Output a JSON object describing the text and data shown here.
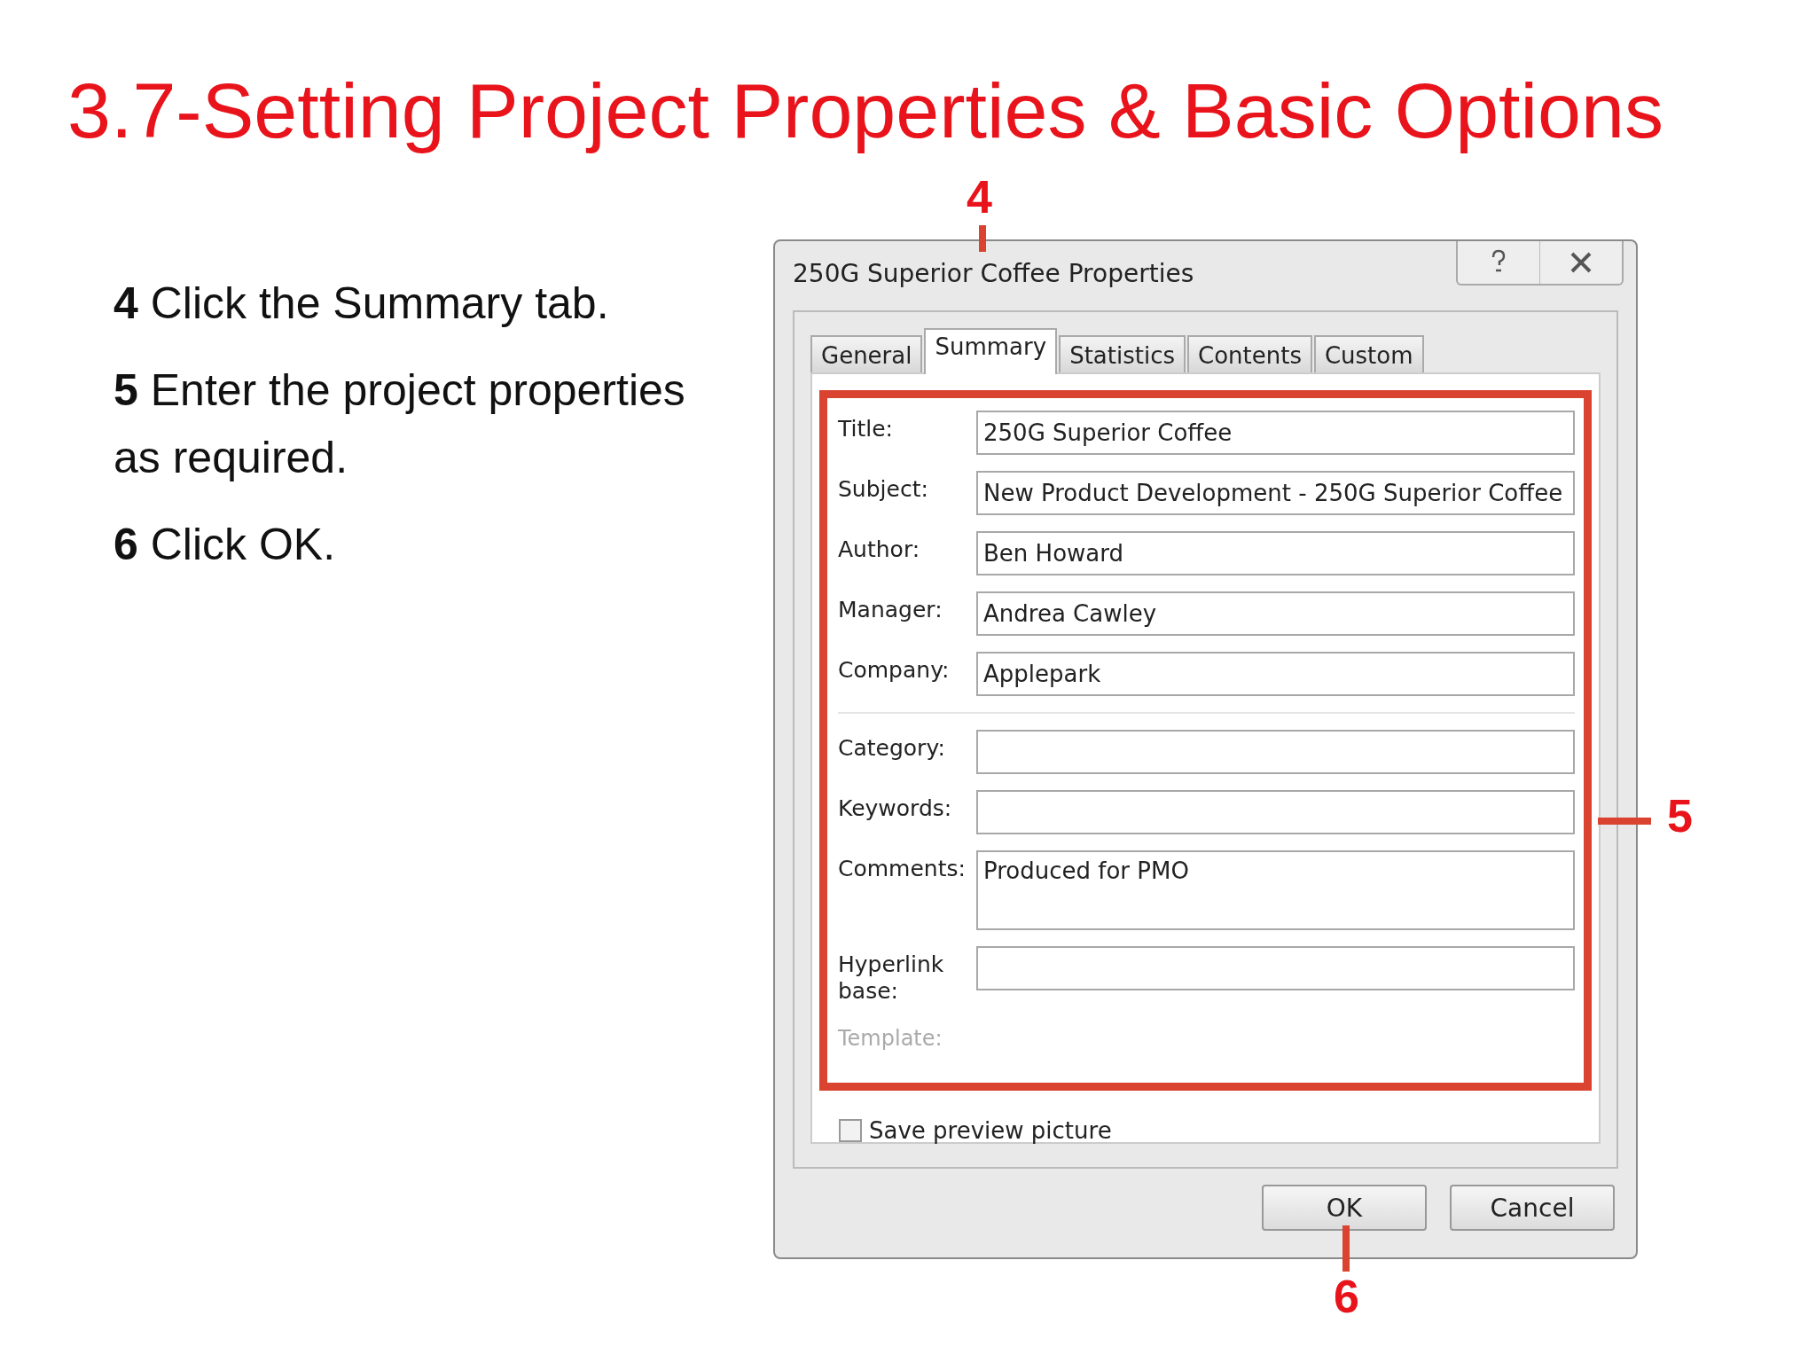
{
  "slide_title": "3.7-Setting Project Properties & Basic Options",
  "steps": [
    {
      "number": "4",
      "text": "Click the Summary tab."
    },
    {
      "number": "5",
      "text": "Enter the project properties as required."
    },
    {
      "number": "6",
      "text": "Click OK."
    }
  ],
  "dialog": {
    "title": "250G Superior Coffee Properties",
    "tabs": [
      {
        "label": "General",
        "selected": false
      },
      {
        "label": "Summary",
        "selected": true
      },
      {
        "label": "Statistics",
        "selected": false
      },
      {
        "label": "Contents",
        "selected": false
      },
      {
        "label": "Custom",
        "selected": false
      }
    ],
    "field_groups": [
      [
        {
          "kind": "text",
          "label": "Title:",
          "value": "250G Superior Coffee"
        },
        {
          "kind": "text",
          "label": "Subject:",
          "value": "New Product Development - 250G Superior Coffee"
        },
        {
          "kind": "text",
          "label": "Author:",
          "value": "Ben Howard"
        },
        {
          "kind": "text",
          "label": "Manager:",
          "value": "Andrea Cawley"
        },
        {
          "kind": "text",
          "label": "Company:",
          "value": "Applepark"
        }
      ],
      [
        {
          "kind": "text",
          "label": "Category:"
        },
        {
          "kind": "text",
          "label": "Keywords:"
        },
        {
          "kind": "multiline",
          "label": "Comments:",
          "value": "Produced for PMO"
        },
        {
          "kind": "text",
          "label": "Hyperlink base:"
        },
        {
          "kind": "label",
          "label": "Template:",
          "disabled": true
        }
      ]
    ],
    "checkbox": {
      "label": "Save preview picture",
      "checked": false
    },
    "buttons": [
      "OK",
      "Cancel"
    ]
  },
  "callouts": [
    {
      "number": "4"
    },
    {
      "number": "5"
    },
    {
      "number": "6"
    }
  ]
}
